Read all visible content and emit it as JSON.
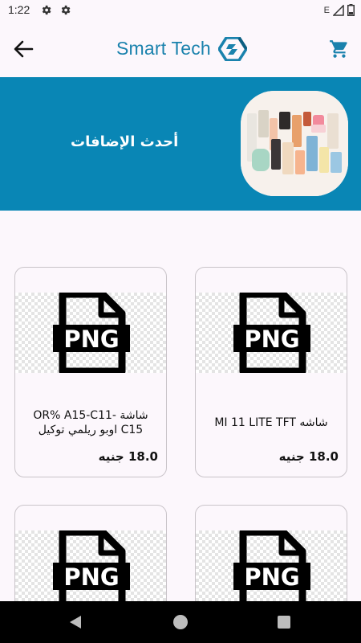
{
  "status_bar": {
    "time": "1:22",
    "network_letter": "E",
    "icons": [
      "settings-icon",
      "settings-icon",
      "signal-icon",
      "battery-icon"
    ]
  },
  "app_bar": {
    "title": "Smart Tech",
    "back_icon": "arrow-left-icon",
    "cart_icon": "shopping-cart-icon",
    "logo": "smart-tech-logo",
    "title_color": "#1a82ad"
  },
  "banner": {
    "title": "أحدث الإضافات",
    "background": "#0986b5",
    "image": "cosmetics-products-image"
  },
  "products": [
    {
      "name": "شاشه MI 11 LITE TFT",
      "price": "18.0 جنيه",
      "image": "png-placeholder-icon"
    },
    {
      "name": "شاشة  OR% A15-C11-C15 اوبو ريلمي توكيل",
      "price": "18.0 جنيه",
      "image": "png-placeholder-icon"
    },
    {
      "name": "",
      "price": "",
      "image": "png-placeholder-icon"
    },
    {
      "name": "",
      "price": "",
      "image": "png-placeholder-icon"
    }
  ],
  "nav_bar": {
    "icons": [
      "nav-back-icon",
      "nav-home-icon",
      "nav-recents-icon"
    ]
  }
}
